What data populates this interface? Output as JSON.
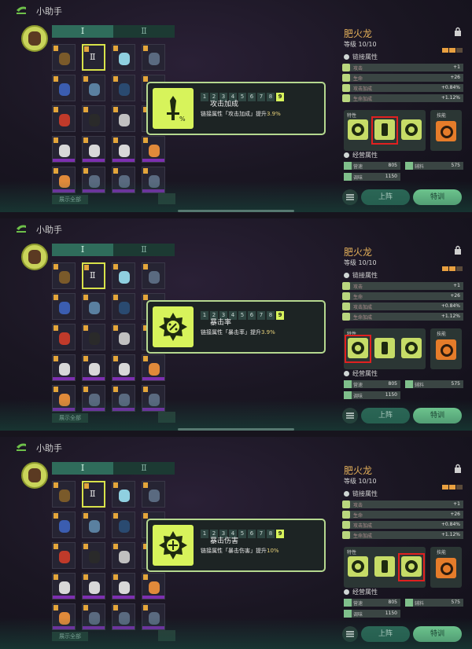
{
  "header": {
    "title": "小助手"
  },
  "tabs": [
    "Ⅰ",
    "Ⅱ"
  ],
  "grid": {
    "selected_label": "Ⅱ",
    "show_all_label": "展示全部"
  },
  "character": {
    "name": "肥火龙",
    "level_label": "等级",
    "level_value": "10/10",
    "link_section": "链接属性",
    "attributes": [
      {
        "label": "攻击",
        "value": "+1"
      },
      {
        "label": "生命",
        "value": "+26"
      },
      {
        "label": "攻击加成",
        "value": "+0.84%"
      },
      {
        "label": "生命加成",
        "value": "+1.12%"
      }
    ],
    "feature_label": "特性",
    "skill_label": "技能",
    "operation_section": "经营属性",
    "operations": [
      {
        "label": "营速",
        "value": "805"
      },
      {
        "label": "辅料",
        "value": "575"
      },
      {
        "label": "调味",
        "value": "1150"
      }
    ],
    "deploy_label": "上阵",
    "train_label": "特训"
  },
  "levels": [
    "1",
    "2",
    "3",
    "4",
    "5",
    "6",
    "7",
    "8",
    "9"
  ],
  "active_level": 9,
  "panels": [
    {
      "popup": {
        "name": "攻击加成",
        "desc_prefix": "链接属性「攻击加成」提升",
        "desc_value": "3.9%"
      },
      "highlighted_feature": 2
    },
    {
      "popup": {
        "name": "暴击率",
        "desc_prefix": "链接属性「暴击率」提升",
        "desc_value": "3.9%"
      },
      "highlighted_feature": 1
    },
    {
      "popup": {
        "name": "暴击伤害",
        "desc_prefix": "链接属性「暴击伤害」提升",
        "desc_value": "10%"
      },
      "highlighted_feature": 3
    }
  ],
  "colors": {
    "accent": "#d7f35b",
    "name": "#e4b05a",
    "highlight": "#e02020",
    "deploy": "#2e6a59",
    "train": "#7bd89a"
  }
}
